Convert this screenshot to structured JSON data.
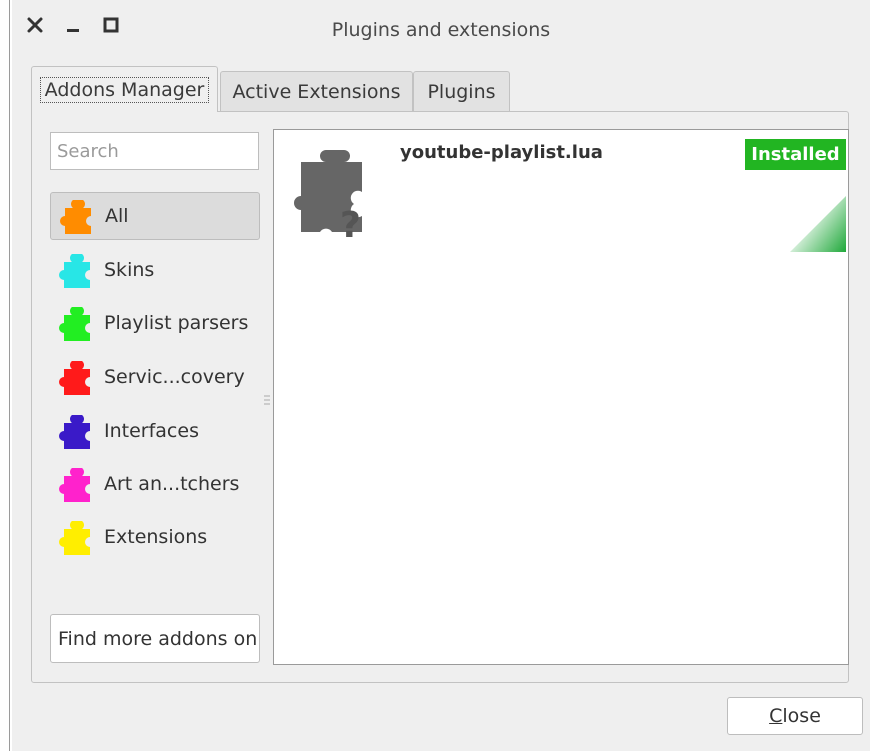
{
  "window": {
    "title": "Plugins and extensions",
    "controls": [
      "close-icon",
      "minimize-icon",
      "maximize-icon"
    ]
  },
  "tabs": [
    {
      "label": "Addons Manager",
      "active": true
    },
    {
      "label": "Active Extensions",
      "active": false
    },
    {
      "label": "Plugins",
      "active": false
    }
  ],
  "search": {
    "placeholder": "Search",
    "value": ""
  },
  "categories": [
    {
      "label": "All",
      "color": "#ff8c00",
      "selected": true
    },
    {
      "label": "Skins",
      "color": "#28e6e6",
      "selected": false
    },
    {
      "label": "Playlist parsers",
      "color": "#22ee22",
      "selected": false
    },
    {
      "label": "Servic...covery",
      "color": "#ff1a1a",
      "selected": false
    },
    {
      "label": "Interfaces",
      "color": "#3a1ac8",
      "selected": false
    },
    {
      "label": "Art an...tchers",
      "color": "#ff22cc",
      "selected": false
    },
    {
      "label": "Extensions",
      "color": "#ffee00",
      "selected": false
    }
  ],
  "find_more_label": "Find more addons on",
  "addons": [
    {
      "name": "youtube-playlist.lua",
      "status": "Installed",
      "status_color": "#22b522",
      "icon": "puzzle-unknown-icon"
    }
  ],
  "close_button": {
    "mnemonic": "C",
    "rest": "lose"
  }
}
